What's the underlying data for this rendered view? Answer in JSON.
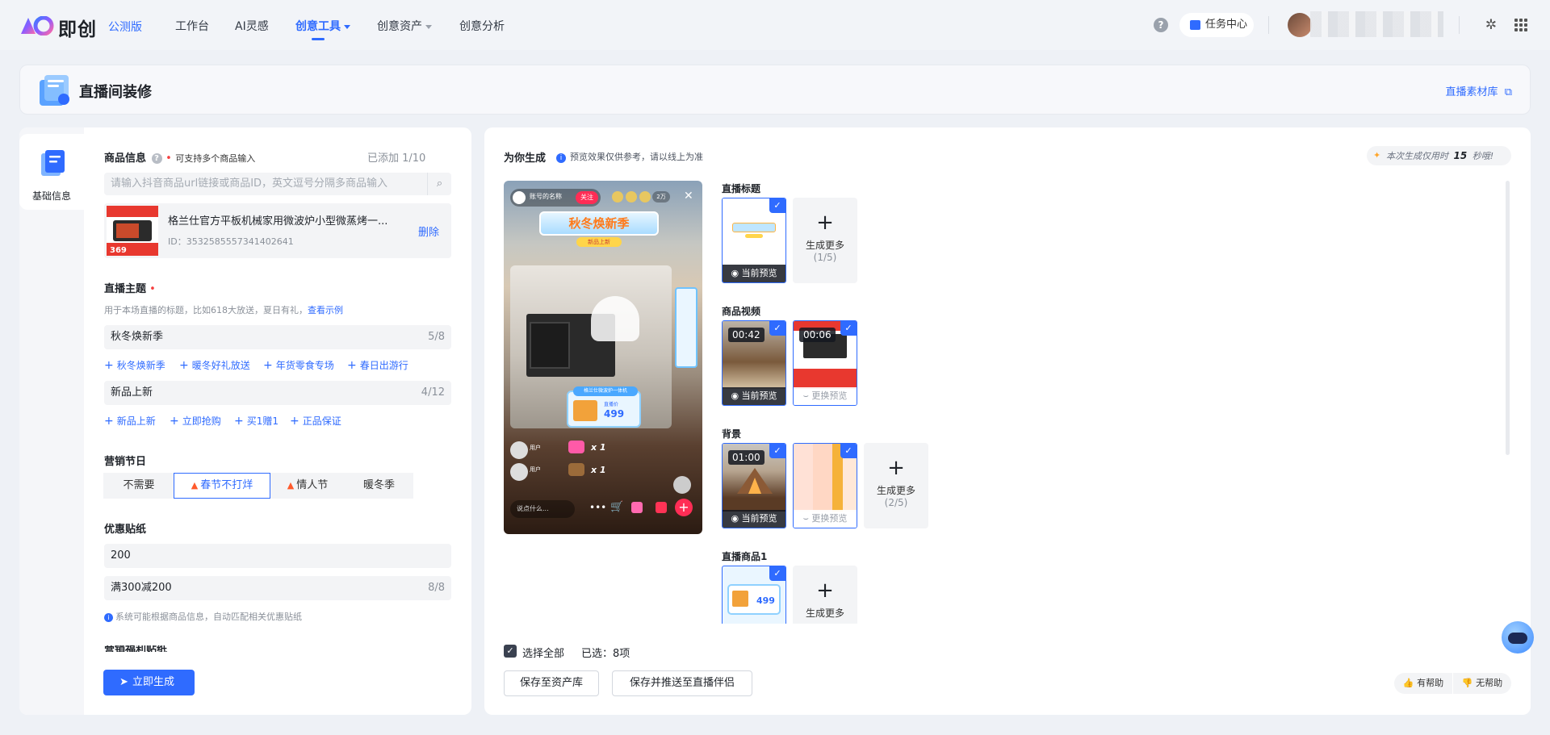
{
  "topbar": {
    "logo_text": "即创",
    "beta_label": "公测版",
    "nav": [
      {
        "label": "工作台"
      },
      {
        "label": "AI灵感"
      },
      {
        "label": "创意工具",
        "active": true,
        "dropdown": true
      },
      {
        "label": "创意资产",
        "dropdown": true
      },
      {
        "label": "创意分析"
      }
    ],
    "task_center_label": "任务中心",
    "help_icon": "question-circle-icon",
    "settings_icon": "gear-icon",
    "apps_icon": "grid-apps-icon"
  },
  "header": {
    "title": "直播间装修",
    "library_link": "直播素材库"
  },
  "sidebar": {
    "tab_label": "基础信息"
  },
  "form": {
    "product": {
      "title": "商品信息",
      "hint": "可支持多个商品输入",
      "added_count": "已添加 1/10",
      "search_placeholder": "请输入抖音商品url链接或商品ID，英文逗号分隔多商品输入",
      "item_name": "格兰仕官方平板机械家用微波炉小型微蒸烤一...",
      "item_id": "ID：3532585557341402641",
      "delete_label": "删除",
      "thumb_price": "369"
    },
    "theme": {
      "title": "直播主题",
      "hint": "用于本场直播的标题，比如618大放送，夏日有礼，",
      "example_link": "查看示例",
      "main_value": "秋冬焕新季",
      "main_count": "5/8",
      "main_suggestions": [
        "秋冬焕新季",
        "暖冬好礼放送",
        "年货零食专场",
        "春日出游行"
      ],
      "sub_value": "新品上新",
      "sub_count": "4/12",
      "sub_suggestions": [
        "新品上新",
        "立即抢购",
        "买1赠1",
        "正品保证"
      ]
    },
    "festival": {
      "title": "营销节日",
      "options": [
        {
          "label": "不需要",
          "flame": false
        },
        {
          "label": "春节不打烊",
          "flame": true,
          "selected": true
        },
        {
          "label": "情人节",
          "flame": true
        },
        {
          "label": "暖冬季",
          "flame": false
        }
      ]
    },
    "coupon": {
      "title": "优惠贴纸",
      "value1": "200",
      "value2": "满300减200",
      "value2_count": "8/8",
      "hint": "系统可能根据商品信息，自动匹配相关优惠贴纸"
    },
    "cut_title": "营销福利贴纸",
    "generate_label": "立即生成"
  },
  "result": {
    "title": "为你生成",
    "hint": "预览效果仅供参考，请以线上为准",
    "timer_prefix": "本次生成仅用时",
    "timer_value": "15",
    "timer_suffix": "秒哦!",
    "preview": {
      "room_name": "账号的名称",
      "follow_label": "关注",
      "viewers": "2万",
      "banner_title": "秋冬焕新季",
      "banner_sub": "新品上新",
      "product_card_title": "格兰仕微波炉一体机",
      "product_card_price": "499",
      "product_card_label": "直播价",
      "gift1_count": "x 1",
      "gift2_count": "x 1",
      "comment1_user": "用户",
      "comment2_user": "用户",
      "comment_placeholder": "说点什么..."
    },
    "groups": {
      "title_group": {
        "label": "直播标题",
        "current_preview": "当前预览",
        "more_label": "生成更多",
        "more_count": "(1/5)"
      },
      "video_group": {
        "label": "商品视频",
        "v1_duration": "00:42",
        "v1_bar": "当前预览",
        "v2_duration": "00:06",
        "v2_bar": "更换预览"
      },
      "bg_group": {
        "label": "背景",
        "b1_duration": "01:00",
        "b1_bar": "当前预览",
        "b2_bar": "更换预览",
        "more_label": "生成更多",
        "more_count": "(2/5)"
      },
      "product_group": {
        "label": "直播商品1",
        "price": "499",
        "more_label": "生成更多"
      }
    },
    "select_all_label": "选择全部",
    "selected_prefix": "已选：",
    "selected_count": "8项",
    "save_asset_label": "保存至资产库",
    "save_push_label": "保存并推送至直播伴侣",
    "helpful_label": "有帮助",
    "not_helpful_label": "无帮助"
  },
  "colors": {
    "accent": "#2f6bff",
    "required": "#f53f3f",
    "flame": "#ff5a2c"
  }
}
